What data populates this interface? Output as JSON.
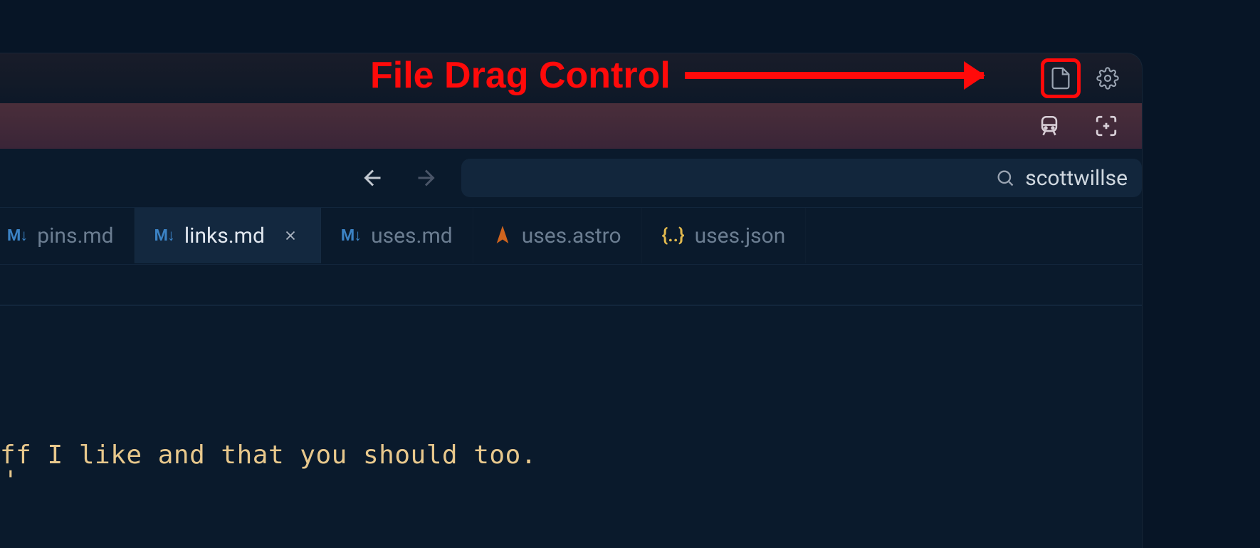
{
  "annotation": {
    "label": "File Drag Control"
  },
  "titlebar": {
    "file_drag_icon": "file-icon",
    "settings_icon": "gear-icon"
  },
  "subtoolbar": {
    "transit_icon": "train-icon",
    "focus_icon": "expand-focus-icon"
  },
  "navigation": {
    "back_icon": "arrow-left-icon",
    "forward_icon": "arrow-right-icon"
  },
  "search": {
    "icon": "search-icon",
    "value": "scottwillse"
  },
  "tabs": [
    {
      "type": "md",
      "label": "pins.md",
      "active": false,
      "close": false
    },
    {
      "type": "md",
      "label": "links.md",
      "active": true,
      "close": true
    },
    {
      "type": "md",
      "label": "uses.md",
      "active": false,
      "close": false
    },
    {
      "type": "astro",
      "label": "uses.astro",
      "active": false,
      "close": false
    },
    {
      "type": "json",
      "label": "uses.json",
      "active": false,
      "close": false
    }
  ],
  "editor": {
    "visible_line": "ff I like and that you should too.",
    "caret_line": "'"
  }
}
